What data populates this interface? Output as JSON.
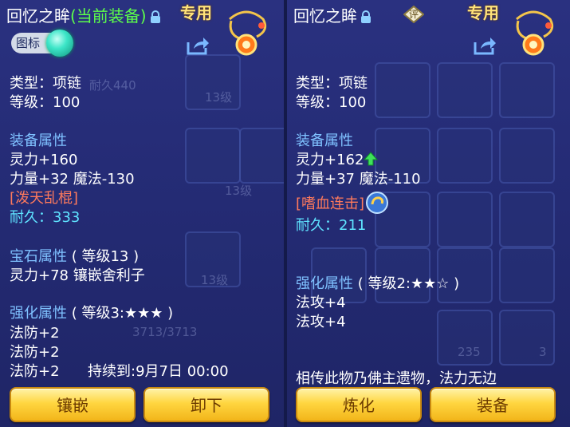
{
  "left": {
    "title": "回忆之眸",
    "current_tag": "(当前装备)",
    "exclusive": "专用",
    "icon_toggle": "图标",
    "type": "类型：项链",
    "level": "等级：100",
    "attr_header": "装备属性",
    "spirit": "灵力+160",
    "str_magic": "力量+32 魔法-130",
    "special": "[泼天乱棍]",
    "dura_label": "耐久：",
    "dura_value": "333",
    "gem_header": "宝石属性",
    "gem_level": "( 等级13 )",
    "gem_attr": "灵力+78 镶嵌舍利子",
    "enh_header": "强化属性",
    "enh_level": "( 等级3:★★★ )",
    "enh_1": "法防+2",
    "enh_2": "法防+2",
    "enh_3": "法防+2",
    "duration": "持续到:9月7日 00:00",
    "btn_inlay": "镶嵌",
    "btn_unequip": "卸下"
  },
  "right": {
    "title": "回忆之眸",
    "appraise": "评",
    "exclusive": "专用",
    "type": "类型：项链",
    "level": "等级：100",
    "attr_header": "装备属性",
    "spirit": "灵力+162",
    "str_magic": "力量+37 魔法-110",
    "special": "[嗜血连击]",
    "dura_label": "耐久：",
    "dura_value": "211",
    "enh_header": "强化属性",
    "enh_level": "( 等级2:★★☆ )",
    "enh_1": "法攻+4",
    "enh_2": "法攻+4",
    "description": "相传此物乃佛主遗物，法力无边",
    "btn_refine": "炼化",
    "btn_equip": "装备"
  },
  "background": {
    "level_tag_1": "13级",
    "level_tag_2": "13级",
    "level_tag_3": "13级",
    "hp": "3713/3713",
    "dura_bg": "耐久440",
    "count_1": "235",
    "count_2": "3"
  },
  "colors": {
    "panel_bg": "#2a3180",
    "section": "#7fc1ff",
    "current_equip": "#5dff4a",
    "special_skill": "#ff7a5c",
    "durability": "#5fe3ff",
    "button": "#ffd640"
  }
}
